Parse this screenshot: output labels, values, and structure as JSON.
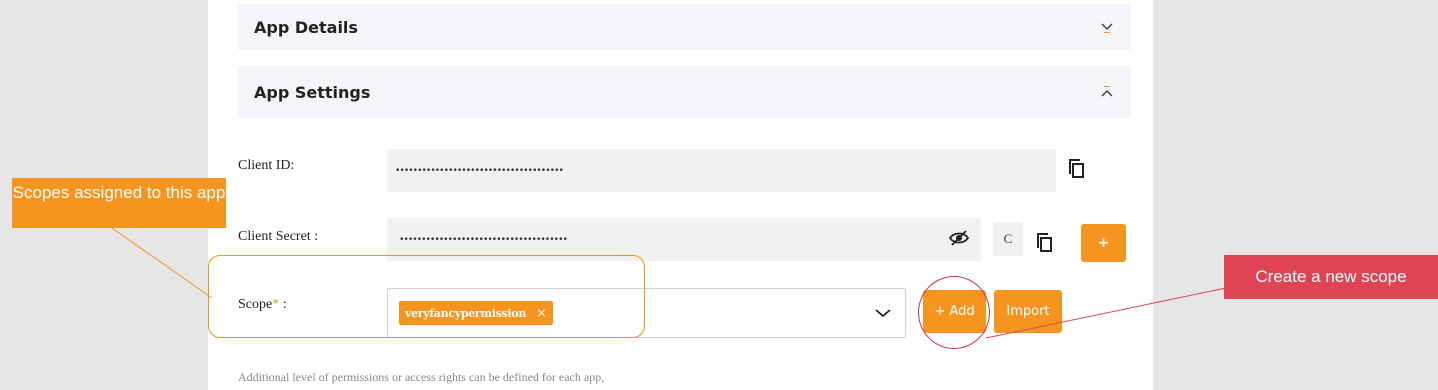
{
  "sections": {
    "app_details": {
      "title": "App Details",
      "icon": "chevron-down-icon"
    },
    "app_settings": {
      "title": "App Settings",
      "icon": "chevron-up-icon"
    }
  },
  "client_id": {
    "label": "Client ID:",
    "value": "••••••••••••••••••••••••••••••••••••••",
    "copy_icon": "copy-icon"
  },
  "client_secret": {
    "label": "Client Secret :",
    "value": "••••••••••••••••••••••••••••••••••••••",
    "toggle_icon": "eye-slash-icon",
    "partial_text": "C",
    "copy_icon": "copy-icon",
    "plus_label": "+"
  },
  "scope": {
    "label": "Scope",
    "required_mark": "*",
    "label_suffix": " :",
    "chip_label": "veryfancypermission",
    "chip_remove": "×",
    "dropdown_icon": "chevron-down-icon",
    "add_label": "+ Add",
    "import_label": "Import"
  },
  "help_text": "Additional level of permissions or access rights can be defined for each app,",
  "annotations": {
    "left_callout": "Scopes assigned to this app",
    "right_callout": "Create a new scope",
    "left_color": "#f5941f",
    "right_color": "#e04454"
  },
  "colors": {
    "accent": "#f5941f",
    "header_bg": "#f4f5f9",
    "field_bg": "#f1f1f1"
  }
}
